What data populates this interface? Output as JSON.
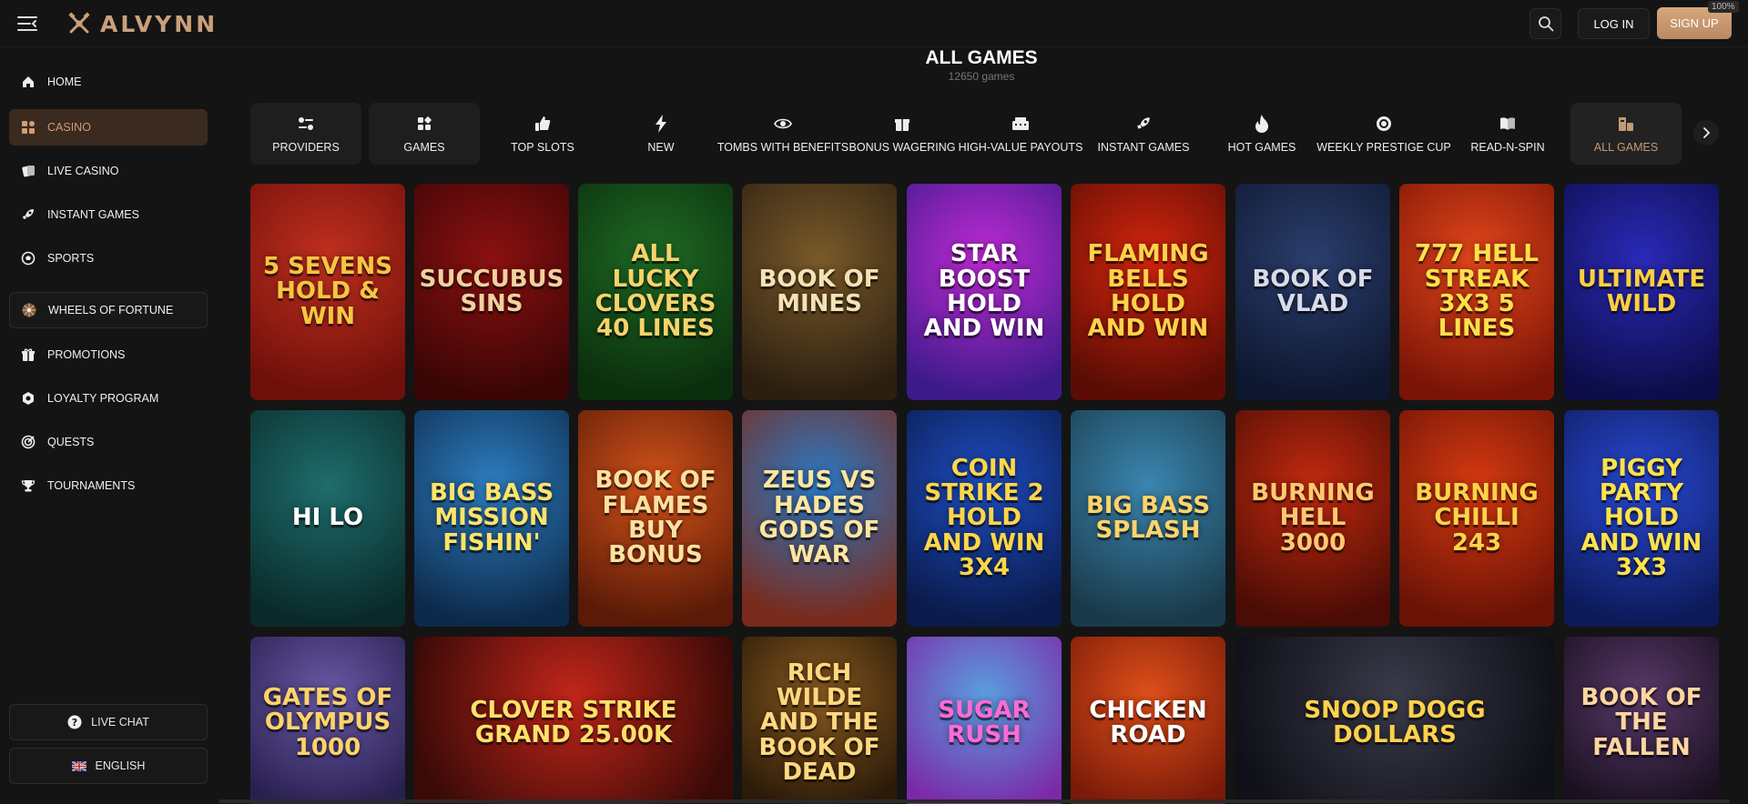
{
  "topbar": {
    "brand": "ALVYNN",
    "login_label": "LOG IN",
    "signup_label": "SIGN UP",
    "zoom_level": "100%",
    "icons": {
      "menu": "menu-collapse-icon",
      "search": "search-icon",
      "logo": "crossed-tools-icon"
    }
  },
  "sidebar": {
    "items": [
      {
        "label": "HOME",
        "icon": "home-icon"
      },
      {
        "label": "CASINO",
        "icon": "grid-icon"
      },
      {
        "label": "LIVE CASINO",
        "icon": "cards-icon"
      },
      {
        "label": "INSTANT GAMES",
        "icon": "rocket-icon"
      },
      {
        "label": "SPORTS",
        "icon": "soccer-ball-icon"
      },
      {
        "label": "WHEELS OF FORTUNE",
        "icon": "wheel-icon"
      },
      {
        "label": "PROMOTIONS",
        "icon": "gift-icon"
      },
      {
        "label": "LOYALTY PROGRAM",
        "icon": "badge-icon"
      },
      {
        "label": "QUESTS",
        "icon": "target-icon"
      },
      {
        "label": "TOURNAMENTS",
        "icon": "trophy-icon"
      }
    ],
    "live_chat_label": "LIVE CHAT",
    "language_label": "ENGLISH"
  },
  "main": {
    "title": "ALL GAMES",
    "subtitle": "12650 games",
    "categories": [
      {
        "label": "PROVIDERS",
        "icon": "sliders-icon"
      },
      {
        "label": "GAMES",
        "icon": "dice-icon"
      },
      {
        "label": "TOP SLOTS",
        "icon": "thumbs-up-icon"
      },
      {
        "label": "NEW",
        "icon": "lightning-icon"
      },
      {
        "label": "TOMBS WITH BENEFITS",
        "icon": "eye-icon"
      },
      {
        "label": "BONUS WAGERING",
        "icon": "gift-box-icon"
      },
      {
        "label": "HIGH-VALUE PAYOUTS",
        "icon": "cash-register-icon"
      },
      {
        "label": "INSTANT GAMES",
        "icon": "rocket-icon"
      },
      {
        "label": "HOT GAMES",
        "icon": "flame-icon"
      },
      {
        "label": "WEEKLY PRESTIGE CUP",
        "icon": "medal-icon"
      },
      {
        "label": "READ-N-SPIN",
        "icon": "book-icon"
      },
      {
        "label": "ALL GAMES",
        "icon": "buildings-icon"
      }
    ],
    "games": [
      {
        "title": "5 Sevens Hold & Win",
        "colors": [
          "#c2301f",
          "#6e0f0a"
        ],
        "text": "#f5c542"
      },
      {
        "title": "Succubus Sins",
        "colors": [
          "#8c1111",
          "#3a0505"
        ],
        "text": "#f2d0a0"
      },
      {
        "title": "All Lucky Clovers 40 Lines",
        "colors": [
          "#1f6b24",
          "#0b2e0d"
        ],
        "text": "#f6d36a"
      },
      {
        "title": "Book of Mines",
        "colors": [
          "#7a5a2a",
          "#2c1f10"
        ],
        "text": "#f4e2b4"
      },
      {
        "title": "Star Boost Hold and Win",
        "colors": [
          "#c12bd6",
          "#3d1a8a"
        ],
        "text": "#ffffff"
      },
      {
        "title": "Flaming Bells Hold and Win",
        "colors": [
          "#d4260d",
          "#5a0c05"
        ],
        "text": "#ffd24a"
      },
      {
        "title": "Book of Vlad",
        "colors": [
          "#2b3e6c",
          "#0e1730"
        ],
        "text": "#d9dbe8"
      },
      {
        "title": "777 Hell Streak 3x3 5 Lines",
        "colors": [
          "#e4461a",
          "#7a1407"
        ],
        "text": "#ffe04a"
      },
      {
        "title": "Ultimate Wild",
        "colors": [
          "#2a2ab8",
          "#0d0d4a"
        ],
        "text": "#ffcf40"
      },
      {
        "title": "Hi Lo",
        "colors": [
          "#1e6d6c",
          "#0a2a2a"
        ],
        "text": "#ffffff"
      },
      {
        "title": "Big Bass Mission Fishin'",
        "colors": [
          "#2d7ec2",
          "#0d2a4a"
        ],
        "text": "#ffe36a"
      },
      {
        "title": "Book of Flames Buy Bonus",
        "colors": [
          "#d4531a",
          "#5a1a07"
        ],
        "text": "#ffe0a0"
      },
      {
        "title": "Zeus vs Hades Gods of War",
        "colors": [
          "#2a7bc8",
          "#7a2a1a"
        ],
        "text": "#ffe6a0"
      },
      {
        "title": "Coin Strike 2 Hold and Win 3x4",
        "colors": [
          "#1e4ec2",
          "#0a1a4a"
        ],
        "text": "#ffd54a"
      },
      {
        "title": "Big Bass Splash",
        "colors": [
          "#3a86b0",
          "#1a3a4a"
        ],
        "text": "#ffd36a"
      },
      {
        "title": "Burning Hell 3000",
        "colors": [
          "#c22a0f",
          "#4a0c05"
        ],
        "text": "#ffc870"
      },
      {
        "title": "Burning Chilli 243",
        "colors": [
          "#d63a10",
          "#6a1206"
        ],
        "text": "#ffd24a"
      },
      {
        "title": "Piggy Party Hold and Win 3x3",
        "colors": [
          "#2a4ad6",
          "#0d1a5a"
        ],
        "text": "#ffe24a"
      },
      {
        "title": "Gates of Olympus 1000",
        "colors": [
          "#6a5aa8",
          "#2a2050"
        ],
        "text": "#ffd36a"
      },
      {
        "title": "Clover Strike Grand 25.00K",
        "colors": [
          "#c2261a",
          "#3a0a07"
        ],
        "text": "#ffe06a"
      },
      {
        "title": "Rich Wilde and the Book of Dead",
        "colors": [
          "#8a5a20",
          "#2a1a08"
        ],
        "text": "#ffd880"
      },
      {
        "title": "Sugar Rush",
        "colors": [
          "#5aa0e0",
          "#7a2aa8"
        ],
        "text": "#ff6ad6"
      },
      {
        "title": "Chicken Road",
        "colors": [
          "#e0501a",
          "#7a1a08"
        ],
        "text": "#ffffff"
      },
      {
        "title": "Snoop Dogg Dollars",
        "colors": [
          "#3a3a4a",
          "#101018"
        ],
        "text": "#ffd24a"
      },
      {
        "title": "Book of the Fallen",
        "colors": [
          "#5a3a6a",
          "#1a1020"
        ],
        "text": "#ffd6a0"
      }
    ]
  }
}
